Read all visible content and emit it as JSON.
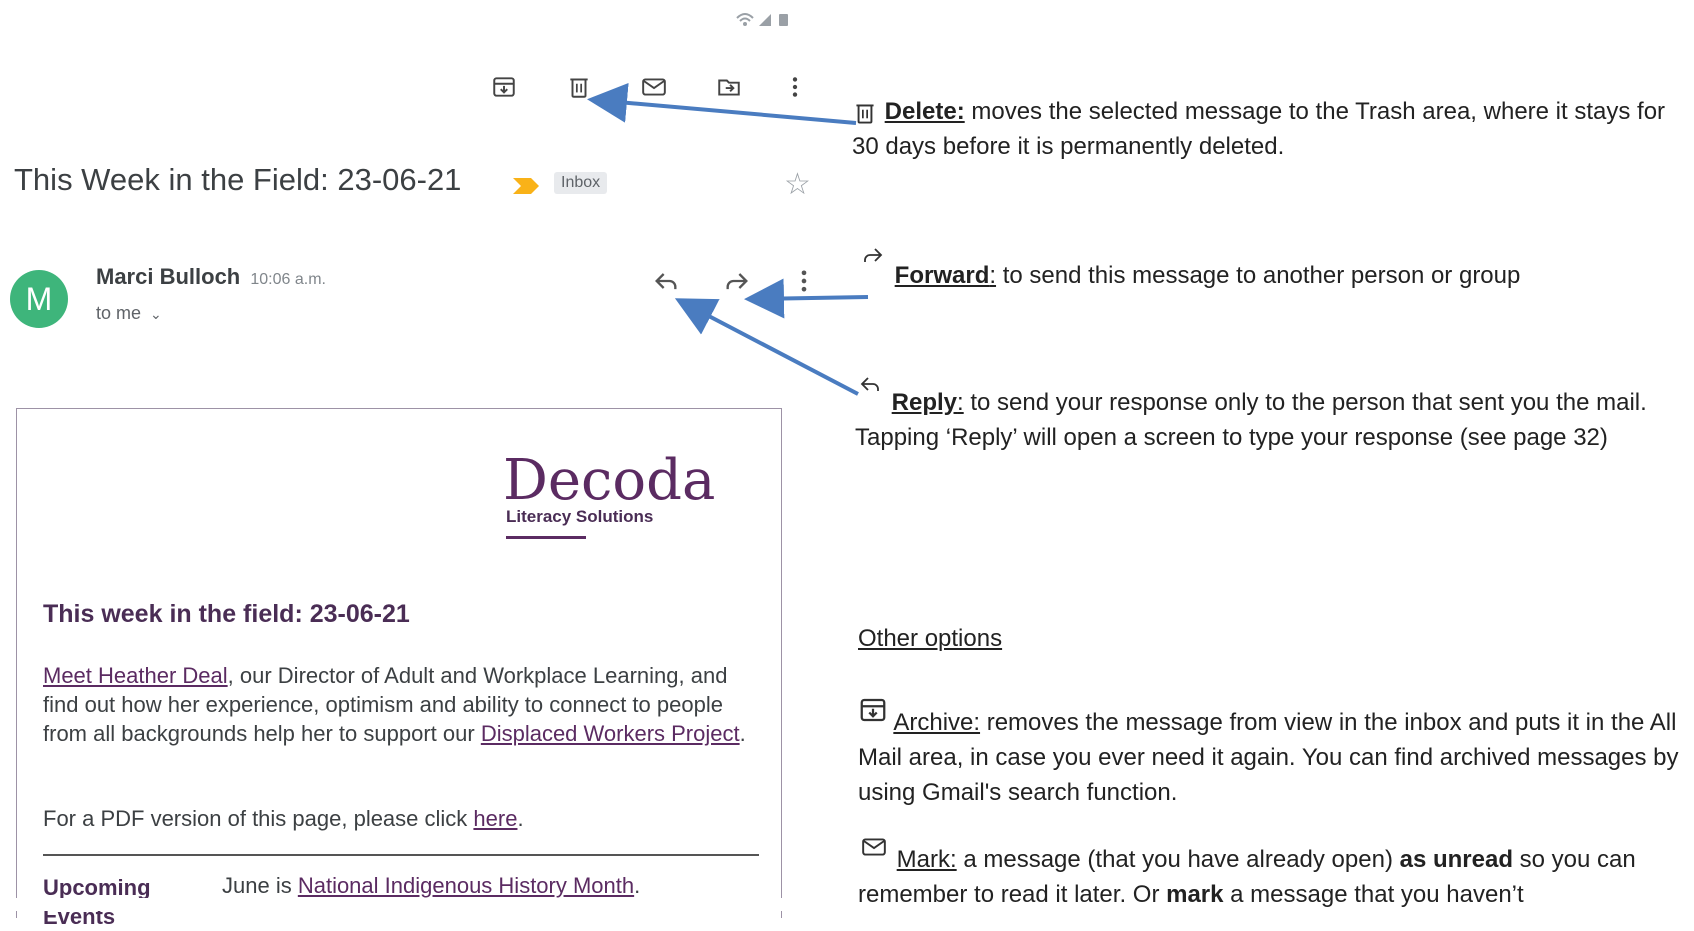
{
  "email": {
    "subject": "This Week in the Field: 23-06-21",
    "label": "Inbox",
    "sender": {
      "name": "Marci Bulloch",
      "time": "10:06 a.m.",
      "to": "to me",
      "initial": "M",
      "avatar_color": "#3eb57b"
    },
    "body": {
      "logo": "Decoda",
      "logo_sub": "Literacy Solutions",
      "heading": "This week in the field: 23-06-21",
      "para_link1": "Meet Heather Deal",
      "para_text1": ", our Director of Adult and Workplace Learning, and find out how her experience, optimism and ability to connect to people from all backgrounds help her to support our ",
      "para_link2": "Displaced Workers Project",
      "para_text2": ".",
      "pdf_text": "For a PDF version of this page, please click ",
      "pdf_link": "here",
      "pdf_end": ".",
      "events_heading": "Upcoming Events",
      "events_text": "June is ",
      "events_link": "National Indigenous History Month",
      "events_end": "."
    }
  },
  "toolbar": {
    "icons": [
      "archive-icon",
      "delete-icon",
      "mark-unread-icon",
      "move-icon",
      "more-icon"
    ]
  },
  "annotations": {
    "delete": {
      "label": "Delete:",
      "text": " moves the selected message to the Trash area, where it stays for 30 days before it is permanently deleted."
    },
    "forward": {
      "label": "Forward",
      "sep": ":",
      "text": " to send this message to another person or group"
    },
    "reply": {
      "label": "Reply",
      "sep": ":",
      "text": " to send your response only to the person that sent you the mail. Tapping ‘Reply’ will open a screen to type your response (see page 32)"
    },
    "other_options": "Other options",
    "archive": {
      "label": "Archive:",
      "text": " removes the message from view in the inbox and puts it in the All Mail area, in case you ever need it again. You can find archived messages by using Gmail's search function."
    },
    "mark": {
      "label": "Mark:",
      "text1": " a message (that you have already open) ",
      "bold1": "as unread",
      "text2": " so you can remember to read it later. Or ",
      "bold2": "mark",
      "text3": " a message that you haven’t"
    }
  },
  "colors": {
    "arrow": "#4a7cc0",
    "brand": "#5b2b62"
  }
}
